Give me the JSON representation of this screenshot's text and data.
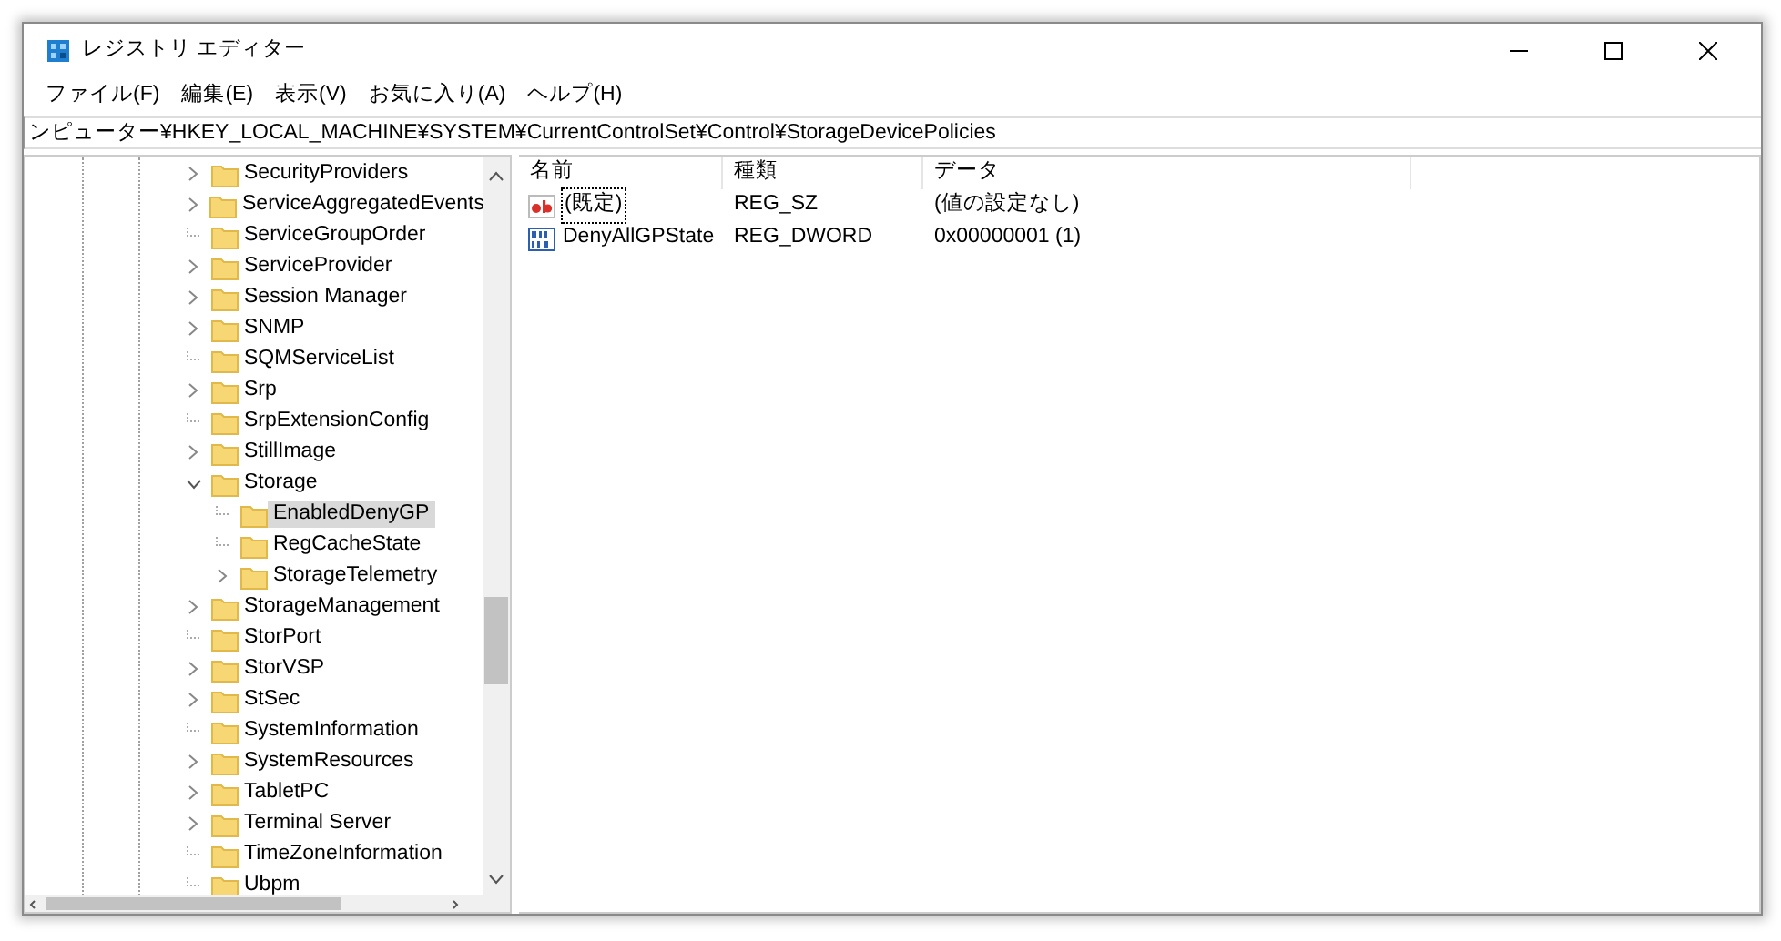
{
  "window": {
    "title": "レジストリ エディター"
  },
  "menu": [
    "ファイル(F)",
    "編集(E)",
    "表示(V)",
    "お気に入り(A)",
    "ヘルプ(H)"
  ],
  "address": "ンピューター¥HKEY_LOCAL_MACHINE¥SYSTEM¥CurrentControlSet¥Control¥StorageDevicePolicies",
  "tree": [
    {
      "label": "SecurityProviders",
      "kind": "collapsed",
      "selected": false
    },
    {
      "label": "ServiceAggregatedEvents",
      "kind": "collapsed",
      "selected": false
    },
    {
      "label": "ServiceGroupOrder",
      "kind": "leaf",
      "selected": false
    },
    {
      "label": "ServiceProvider",
      "kind": "collapsed",
      "selected": false
    },
    {
      "label": "Session Manager",
      "kind": "collapsed",
      "selected": false
    },
    {
      "label": "SNMP",
      "kind": "collapsed",
      "selected": false
    },
    {
      "label": "SQMServiceList",
      "kind": "leaf",
      "selected": false
    },
    {
      "label": "Srp",
      "kind": "collapsed",
      "selected": false
    },
    {
      "label": "SrpExtensionConfig",
      "kind": "leaf",
      "selected": false
    },
    {
      "label": "StillImage",
      "kind": "collapsed",
      "selected": false
    },
    {
      "label": "Storage",
      "kind": "expanded",
      "selected": false,
      "children": [
        {
          "label": "EnabledDenyGP",
          "kind": "leaf",
          "selected": true
        },
        {
          "label": "RegCacheState",
          "kind": "leaf",
          "selected": false
        },
        {
          "label": "StorageTelemetry",
          "kind": "collapsed",
          "selected": false
        }
      ]
    },
    {
      "label": "StorageManagement",
      "kind": "collapsed",
      "selected": false
    },
    {
      "label": "StorPort",
      "kind": "leaf",
      "selected": false
    },
    {
      "label": "StorVSP",
      "kind": "collapsed",
      "selected": false
    },
    {
      "label": "StSec",
      "kind": "collapsed",
      "selected": false
    },
    {
      "label": "SystemInformation",
      "kind": "leaf",
      "selected": false
    },
    {
      "label": "SystemResources",
      "kind": "collapsed",
      "selected": false
    },
    {
      "label": "TabletPC",
      "kind": "collapsed",
      "selected": false
    },
    {
      "label": "Terminal Server",
      "kind": "collapsed",
      "selected": false
    },
    {
      "label": "TimeZoneInformation",
      "kind": "leaf",
      "selected": false
    },
    {
      "label": "Ubpm",
      "kind": "leaf",
      "selected": false
    }
  ],
  "table": {
    "columns": [
      "名前",
      "種類",
      "データ"
    ],
    "rows": [
      {
        "kind": "string",
        "name": "(既定)",
        "type": "REG_SZ",
        "data": "(値の設定なし)",
        "focused": true
      },
      {
        "kind": "binary",
        "name": "DenyAllGPState",
        "type": "REG_DWORD",
        "data": "0x00000001 (1)",
        "focused": false
      }
    ]
  }
}
